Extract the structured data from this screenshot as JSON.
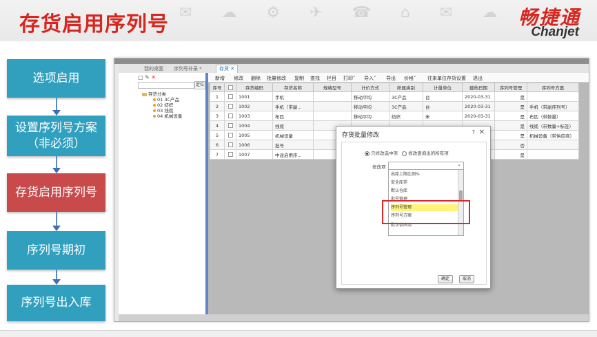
{
  "slide": {
    "title": "存货启用序列号",
    "logo_cn": "畅捷通",
    "logo_en": "Chanjet",
    "steps": [
      {
        "label": "选项启用",
        "active": false
      },
      {
        "label": "设置序列号方案（非必须）",
        "active": false
      },
      {
        "label": "存货启用序列号",
        "active": true
      },
      {
        "label": "序列号期初",
        "active": false
      },
      {
        "label": "序列号出入库",
        "active": false
      }
    ],
    "colors": {
      "title": "#d7261f",
      "step": "#31a0bf",
      "step_active": "#c94a4a",
      "annotation": "#e0252a"
    }
  },
  "app": {
    "tabs": [
      "我的桌面",
      "序列号补录 *",
      "存货 ✕"
    ],
    "tree": {
      "search_button": "定位",
      "root": "存货分类",
      "nodes": [
        "01 3C产品",
        "02 纺织",
        "03 线缆",
        "04 机械设备"
      ]
    },
    "toolbar": [
      "新增",
      "修改",
      "删除",
      "批量修改",
      "复制",
      "查找",
      "栏目",
      "打印˅",
      "导入˅",
      "导出",
      "价格˅",
      "往来单位存货设置",
      "退出"
    ],
    "grid": {
      "headers": [
        "序号",
        "",
        "存货编码",
        "存货名称",
        "规格型号",
        "计价方式",
        "所属类别",
        "计量单位",
        "建档日期",
        "序列号管理",
        "序列号方案"
      ],
      "rows": [
        [
          "1",
          "",
          "1001",
          "手机",
          "",
          "移动平均",
          "3C产品",
          "台",
          "2020-03-31",
          "是",
          ""
        ],
        [
          "2",
          "",
          "1002",
          "手机（带副...",
          "",
          "移动平均",
          "3C产品",
          "台",
          "2020-03-31",
          "是",
          "手机（带副序列号）"
        ],
        [
          "3",
          "",
          "1003",
          "布匹",
          "",
          "移动平均",
          "纺织",
          "米",
          "2020-03-31",
          "是",
          "布匹（带数量）"
        ],
        [
          "4",
          "",
          "1004",
          "线缆",
          "",
          "",
          "",
          "",
          "",
          "是",
          "线缆（带数量+标签）"
        ],
        [
          "5",
          "",
          "1005",
          "机械设备",
          "",
          "",
          "",
          "",
          "",
          "是",
          "机械设备（带供应商）"
        ],
        [
          "6",
          "",
          "1006",
          "批号",
          "",
          "",
          "",
          "",
          "",
          "否",
          ""
        ],
        [
          "7",
          "",
          "1007",
          "中途启用序...",
          "",
          "",
          "",
          "",
          "",
          "是",
          ""
        ]
      ]
    },
    "modal": {
      "title": "存货批量修改",
      "help_icon": "?",
      "close_icon": "✕",
      "radio_selected": "只修改选中项",
      "radio_other": "修改查询出的所有项",
      "field_label": "修改项",
      "select_arrow": "⌄",
      "options": [
        "出库上限比例%",
        "安全库存",
        "默认仓库",
        "批号管理",
        "序列号管理",
        "序列号方案",
        "默认供应商"
      ],
      "highlighted_option": "序列号管理",
      "ok_label": "确定",
      "cancel_label": "取消"
    }
  }
}
